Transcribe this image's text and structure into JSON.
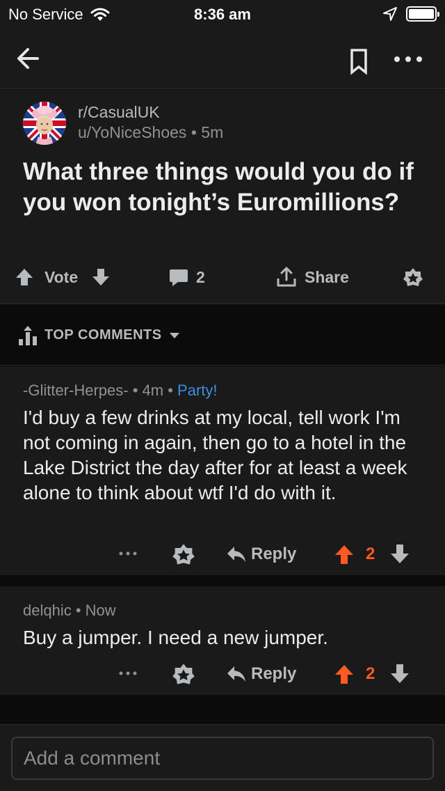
{
  "status_bar": {
    "carrier": "No Service",
    "time": "8:36 am",
    "battery_level": 1.0
  },
  "post": {
    "subreddit": "r/CasualUK",
    "author": "u/YoNiceShoes",
    "age": "5m",
    "meta_separator": "•",
    "title": "What three things would you do if you won tonight’s Euromillions?",
    "vote_label": "Vote",
    "comment_count": "2",
    "share_label": "Share"
  },
  "sort": {
    "label": "TOP COMMENTS"
  },
  "comments": [
    {
      "author": "-Glitter-Herpes-",
      "age": "4m",
      "flair": "Party!",
      "body": "I'd buy a few drinks at my local, tell work I'm not coming in again, then go to a hotel in the Lake District the day after for at least a week alone to think about wtf I'd do with it.",
      "reply_label": "Reply",
      "score": "2"
    },
    {
      "author": "delqhic",
      "age": "Now",
      "body": "Buy a jumper. I need a new jumper.",
      "reply_label": "Reply",
      "score": "2"
    }
  ],
  "composer": {
    "placeholder": "Add a comment"
  },
  "colors": {
    "background": "#0b0b0b",
    "card": "#1a1a1b",
    "upvote": "#ff5a1f",
    "flair": "#3c8ee0",
    "muted_text": "#8f9294"
  }
}
